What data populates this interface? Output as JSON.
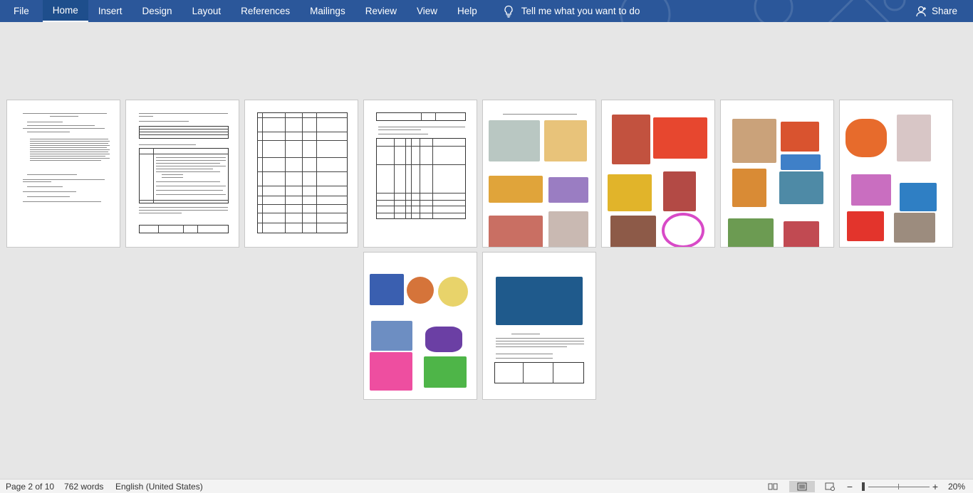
{
  "ribbon": {
    "tabs": [
      {
        "label": "File"
      },
      {
        "label": "Home"
      },
      {
        "label": "Insert"
      },
      {
        "label": "Design"
      },
      {
        "label": "Layout"
      },
      {
        "label": "References"
      },
      {
        "label": "Mailings"
      },
      {
        "label": "Review"
      },
      {
        "label": "View"
      },
      {
        "label": "Help"
      }
    ],
    "tell_me": "Tell me what you want to do",
    "share": "Share"
  },
  "status": {
    "page": "Page 2 of 10",
    "words": "762 words",
    "language": "English (United States)",
    "zoom": "20%"
  },
  "colors": {
    "ribbon": "#2b579a",
    "background": "#e6e6e6",
    "status_bar": "#f3f3f3"
  },
  "icons": [
    "lightbulb-icon",
    "person-icon",
    "read-mode-icon",
    "print-layout-icon",
    "web-layout-icon",
    "zoom-out-icon",
    "zoom-in-icon"
  ]
}
